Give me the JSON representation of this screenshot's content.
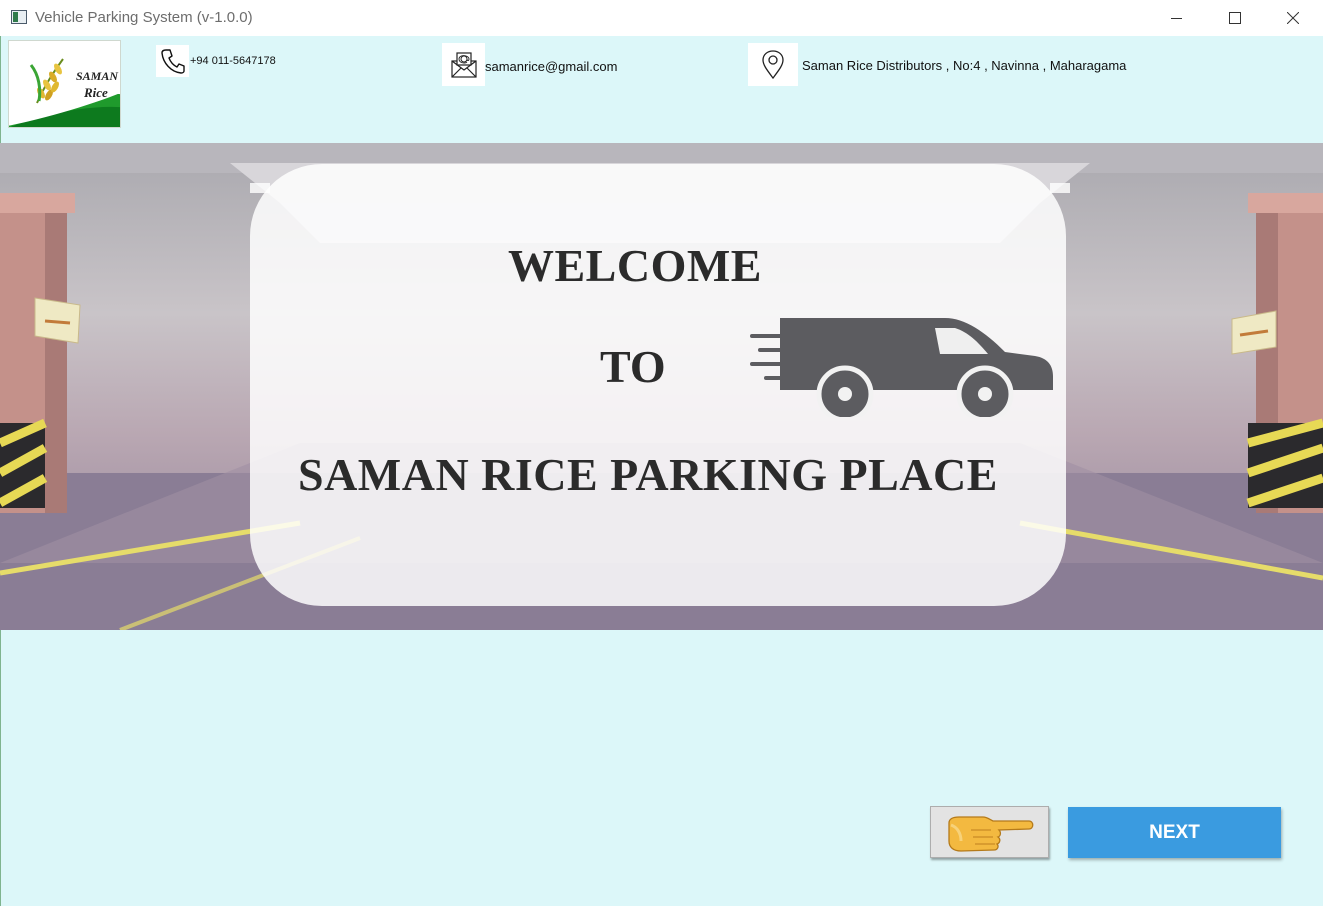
{
  "window": {
    "title": "Vehicle Parking System (v-1.0.0)",
    "controls": [
      "minimize",
      "maximize",
      "close"
    ]
  },
  "header": {
    "logo": {
      "line1": "SAMAN",
      "line2": "Rice"
    },
    "phone": {
      "icon": "phone-icon",
      "text": "+94 011-5647178"
    },
    "email": {
      "icon": "mail-icon",
      "text": "samanrice@gmail.com"
    },
    "address": {
      "icon": "location-pin-icon",
      "text": "Saman Rice Distributors , No:4 , Navinna , Maharagama"
    }
  },
  "banner": {
    "line1": "WELCOME",
    "line2": "TO",
    "line3": "SAMAN RICE PARKING PLACE",
    "illustration": "delivery-van-icon"
  },
  "actions": {
    "pointer_icon": "pointing-hand-icon",
    "next_label": "NEXT"
  },
  "colors": {
    "background": "#dcf7f9",
    "next_button": "#3a9be0",
    "heading_text": "#2b2b2b"
  }
}
